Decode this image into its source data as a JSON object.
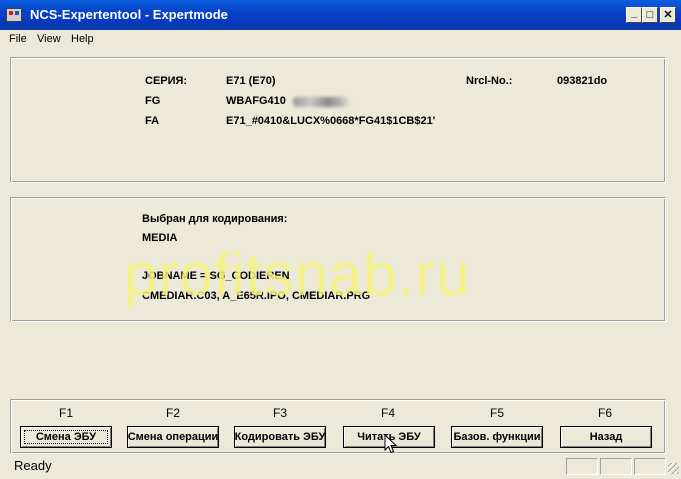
{
  "window": {
    "title": "NCS-Expertentool - Expertmode"
  },
  "title_buttons": {
    "minimize": "_",
    "maximize": "□",
    "close": "✕"
  },
  "menu": [
    "File",
    "View",
    "Help"
  ],
  "vehicle": {
    "series_label": "СЕРИЯ:",
    "series_value": "E71 (E70)",
    "nrcl_label": "Nrcl-No.:",
    "nrcl_value": "093821do",
    "fg_label": "FG",
    "fg_value": "WBAFG410",
    "fa_label": "FA",
    "fa_value": "E71_#0410&LUCX%0668*FG41$1CB$21'"
  },
  "coding": {
    "selected_label": "Выбран для кодирования:",
    "module": "MEDIA",
    "jobname": "JOBNAME = SG_CODIEREN",
    "files": "CMEDIAR.C03, A_E65R.IPO, CMEDIAR.PRG"
  },
  "watermark": "profitsnab.ru",
  "function_keys": [
    {
      "key": "F1",
      "label": "Смена ЭБУ"
    },
    {
      "key": "F2",
      "label": "Смена операции"
    },
    {
      "key": "F3",
      "label": "Кодировать ЭБУ"
    },
    {
      "key": "F4",
      "label": "Читать ЭБУ"
    },
    {
      "key": "F5",
      "label": "Базов. функции"
    },
    {
      "key": "F6",
      "label": "Назад"
    }
  ],
  "status": {
    "text": "Ready"
  }
}
